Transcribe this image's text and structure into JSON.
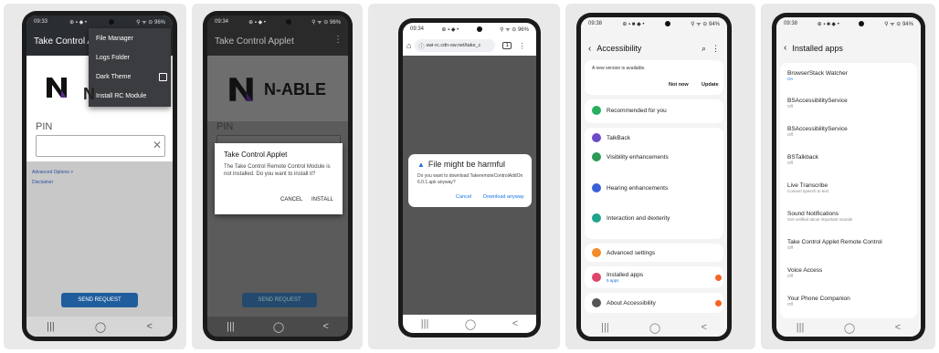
{
  "colors": {
    "brand_purple": "#5b2b8c",
    "brand_blue": "#1f5d9c",
    "dialog_blue": "#1a73e8",
    "samsung_orange": "#f26522"
  },
  "phone1": {
    "status_time": "09:33",
    "status_icons": "⊕ ▪ ◆ •",
    "status_right": "⚲ ᯤ ⊝ 96%",
    "app_title": "Take Control App",
    "menu": [
      {
        "label": "File Manager"
      },
      {
        "label": "Logs Folder"
      },
      {
        "label": "Dark Theme",
        "checkbox": true
      },
      {
        "label": "Install RC Module"
      }
    ],
    "logo_letter": "N",
    "pin_label": "PIN",
    "clear_icon": "close-icon",
    "advanced_options": "Advanced Options  >",
    "disclaimer": "Disclaimer",
    "send_request": "SEND REQUEST",
    "nav": [
      "|||",
      "◯",
      "<"
    ]
  },
  "phone2": {
    "status_time": "09:34",
    "status_icons": "⊕ ▪ ◆ •",
    "status_right": "⚲ ᯤ ⊝ 96%",
    "app_title": "Take Control Applet",
    "overflow_icon": "⋮",
    "logo_text": "N-ABLE",
    "pin_label": "PIN",
    "dialog_title": "Take Control Applet",
    "dialog_body": "The Take Control Remote Control Module is not installed. Do you want to install it?",
    "dialog_cancel": "CANCEL",
    "dialog_install": "INSTALL",
    "send_request": "SEND REQUEST",
    "nav": [
      "|||",
      "◯",
      "<"
    ]
  },
  "phone3": {
    "status_time": "09:34",
    "status_icons": "⊕ ▪ ◆ •",
    "status_right": "⚲ ᯤ ⊝ 96%",
    "url": "swi-rc.cdn-sw.net/take_c",
    "tab_count": "1",
    "dialog_title": "File might be harmful",
    "dialog_body": "Do you want to download TakeremoteControlAddOn 6.0.1.apk anyway?",
    "cancel": "Cancel",
    "download": "Download anyway",
    "nav": [
      "|||",
      "◯",
      "<"
    ]
  },
  "phone4": {
    "status_time": "09:38",
    "status_icons": "⊕ ▪ ■ ◆ •",
    "status_right": "⚲ ᯤ ⊝ 94%",
    "title": "Accessibility",
    "update_notice": "A new version is available.",
    "not_now": "Not now",
    "update": "Update",
    "items": [
      {
        "label": "Recommended for you",
        "color": "#27ae60"
      },
      {
        "label": "TalkBack",
        "color": "#6c4cc9"
      },
      {
        "label": "Visibility enhancements",
        "color": "#2e9a57"
      },
      {
        "label": "Hearing enhancements",
        "color": "#3a5fd9"
      },
      {
        "label": "Interaction and dexterity",
        "color": "#1fa38c"
      },
      {
        "label": "Advanced settings",
        "color": "#f28c28"
      },
      {
        "label": "Installed apps",
        "sub": "5 apps",
        "color": "#e0446b",
        "badge": true
      },
      {
        "label": "About Accessibility",
        "color": "#555555",
        "badge": true
      }
    ],
    "nav": [
      "|||",
      "◯",
      "<"
    ]
  },
  "phone5": {
    "status_time": "09:38",
    "status_icons": "⊕ ▪ ■ ◆ •",
    "status_right": "⚲ ᯤ ⊝ 94%",
    "title": "Installed apps",
    "items": [
      {
        "label": "BrowserStack Watcher",
        "sub": "On",
        "sub_color": "#1a73e8"
      },
      {
        "label": "BSAccessibilityService",
        "sub": "Off"
      },
      {
        "label": "BSAccessibilityService",
        "sub": "Off"
      },
      {
        "label": "BSTalkback",
        "sub": "Off"
      },
      {
        "label": "Live Transcribe",
        "sub": "Convert speech to text"
      },
      {
        "label": "Sound Notifications",
        "sub": "Get notified about important sounds"
      },
      {
        "label": "Take Control Applet Remote Control",
        "sub": "Off"
      },
      {
        "label": "Voice Access",
        "sub": "Off"
      },
      {
        "label": "Your Phone Companion",
        "sub": "Off"
      }
    ],
    "nav": [
      "|||",
      "◯",
      "<"
    ]
  }
}
